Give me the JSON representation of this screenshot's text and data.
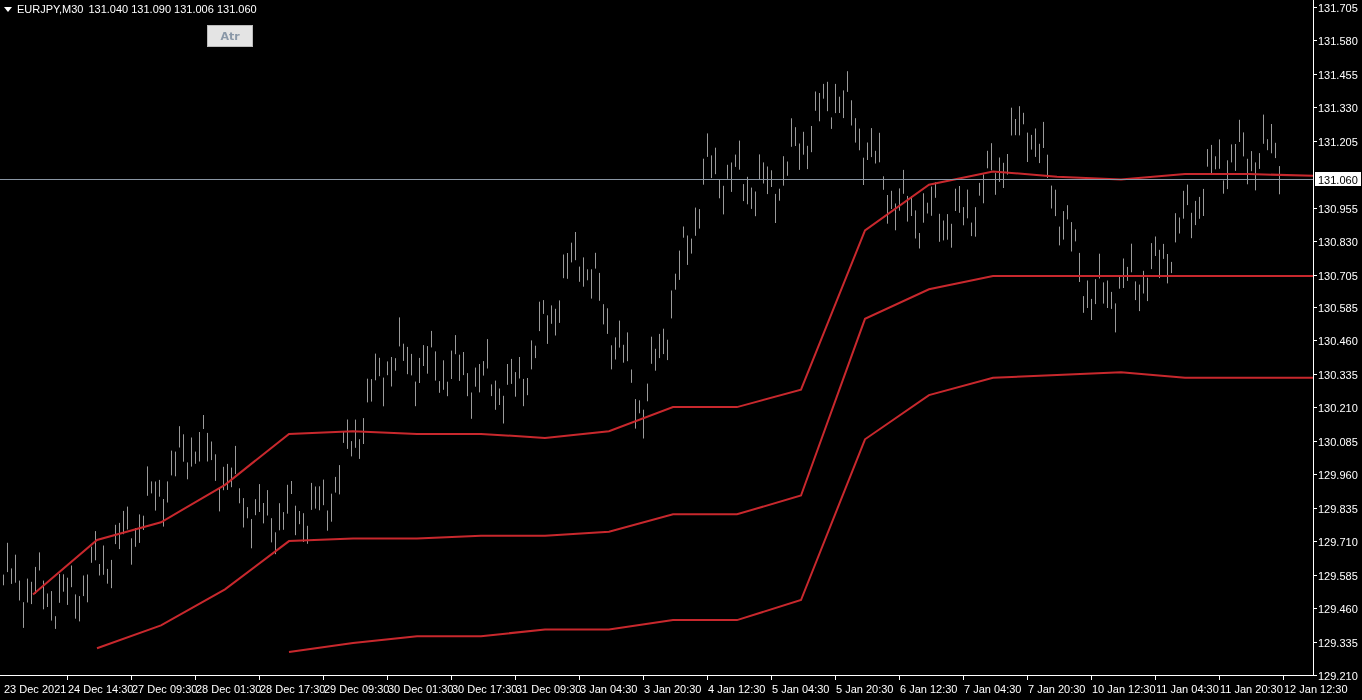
{
  "header": {
    "symbol": "EURJPY,M30",
    "quote": "131.040 131.090 131.006 131.060"
  },
  "indicator_button": {
    "label": "Atr"
  },
  "current_price": {
    "label": "131.060"
  },
  "chart_data": {
    "type": "line",
    "categories": [
      "23 Dec 2021",
      "24 Dec 14:30",
      "27 Dec 09:30",
      "28 Dec 01:30",
      "28 Dec 17:30",
      "29 Dec 09:30",
      "30 Dec 01:30",
      "30 Dec 17:30",
      "31 Dec 09:30",
      "3 Jan 04:30",
      "3 Jan 20:30",
      "4 Jan 12:30",
      "5 Jan 04:30",
      "5 Jan 20:30",
      "6 Jan 12:30",
      "7 Jan 04:30",
      "7 Jan 20:30",
      "10 Jan 12:30",
      "11 Jan 04:30",
      "11 Jan 20:30",
      "12 Jan 12:30"
    ],
    "series": [
      {
        "color": "#c8282d",
        "values": [
          129.51,
          129.714,
          129.78,
          129.92,
          130.11,
          130.12,
          130.11,
          130.11,
          130.095,
          130.12,
          130.21,
          130.21,
          130.275,
          130.87,
          131.04,
          131.09,
          131.07,
          131.06,
          131.08,
          131.08,
          131.074
        ]
      },
      {
        "color": "#c8282d",
        "values": [
          null,
          129.31,
          129.395,
          129.53,
          129.71,
          129.72,
          129.72,
          129.73,
          129.73,
          129.745,
          129.81,
          129.81,
          129.88,
          130.54,
          130.65,
          130.7,
          130.7,
          130.7,
          130.7,
          130.7,
          130.7
        ]
      },
      {
        "color": "#c8282d",
        "values": [
          null,
          null,
          null,
          null,
          129.296,
          129.33,
          129.355,
          129.355,
          129.38,
          129.38,
          129.415,
          129.415,
          129.49,
          130.09,
          130.255,
          130.32,
          130.33,
          130.34,
          130.32,
          130.32,
          130.32
        ]
      }
    ],
    "ylim": [
      129.21,
      131.73
    ],
    "yticks": [
      {
        "value": 131.705,
        "label": "131.705"
      },
      {
        "value": 131.58,
        "label": "131.580"
      },
      {
        "value": 131.455,
        "label": "131.455"
      },
      {
        "value": 131.33,
        "label": "131.330"
      },
      {
        "value": 131.205,
        "label": "131.205"
      },
      {
        "value": 130.955,
        "label": "130.955"
      },
      {
        "value": 130.83,
        "label": "130.830"
      },
      {
        "value": 130.705,
        "label": "130.705"
      },
      {
        "value": 130.585,
        "label": "130.585"
      },
      {
        "value": 130.46,
        "label": "130.460"
      },
      {
        "value": 130.335,
        "label": "130.335"
      },
      {
        "value": 130.21,
        "label": "130.210"
      },
      {
        "value": 130.085,
        "label": "130.085"
      },
      {
        "value": 129.96,
        "label": "129.960"
      },
      {
        "value": 129.835,
        "label": "129.835"
      },
      {
        "value": 129.71,
        "label": "129.710"
      },
      {
        "value": 129.585,
        "label": "129.585"
      },
      {
        "value": 129.46,
        "label": "129.460"
      },
      {
        "value": 129.335,
        "label": "129.335"
      },
      {
        "value": 129.21,
        "label": "129.210"
      }
    ]
  }
}
